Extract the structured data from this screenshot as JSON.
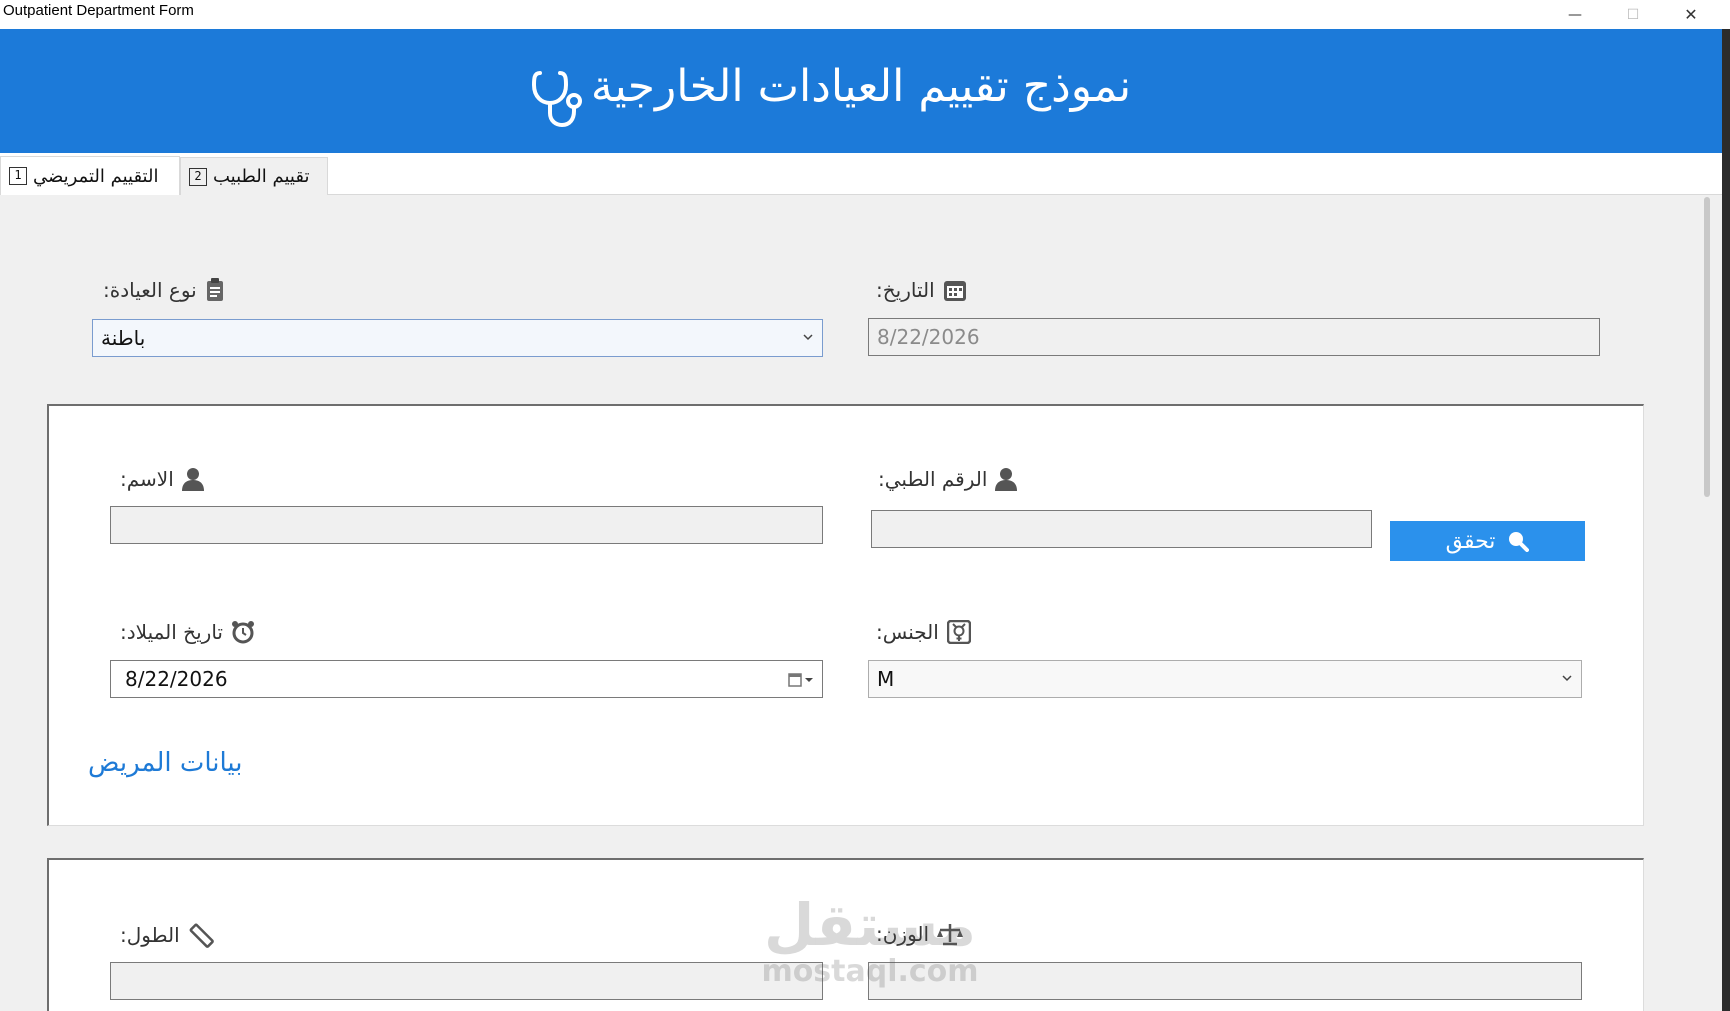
{
  "window": {
    "title": "Outpatient Department Form",
    "controls": {
      "minimize": "—",
      "maximize": "☐",
      "close": "✕"
    }
  },
  "header": {
    "title": "نموذج تقييم العيادات الخارجية",
    "icon": "stethoscope-icon",
    "background": "#1c7ad9"
  },
  "tabs": [
    {
      "number": "1",
      "label": "التقييم التمريضي",
      "active": true
    },
    {
      "number": "2",
      "label": "تقييم الطبيب",
      "active": false
    }
  ],
  "clinic": {
    "label": "نوع العيادة:",
    "icon": "clipboard-icon",
    "value": "باطنة"
  },
  "date": {
    "label": "التاريخ:",
    "icon": "calendar-icon",
    "value": "8/22/2026"
  },
  "patient": {
    "section_title": "بيانات المريض",
    "name_label": "الاسم:",
    "name_value": "",
    "mrn_label": "الرقم الطبي:",
    "mrn_value": "",
    "verify_label": "تحقق",
    "verify_icon": "search-icon",
    "dob_label": "تاريخ الميلاد:",
    "dob_icon": "alarm-clock-icon",
    "dob_value": "8/22/2026",
    "gender_label": "الجنس:",
    "gender_icon": "gender-icon",
    "gender_value": "M",
    "accent": "#2b91ec"
  },
  "vitals": {
    "height_label": "الطول:",
    "height_icon": "ruler-icon",
    "height_value": "",
    "weight_label": "الوزن:",
    "weight_icon": "scale-icon",
    "weight_value": ""
  },
  "watermark": {
    "arabic": "مستقل",
    "latin": "mostaql.com"
  }
}
